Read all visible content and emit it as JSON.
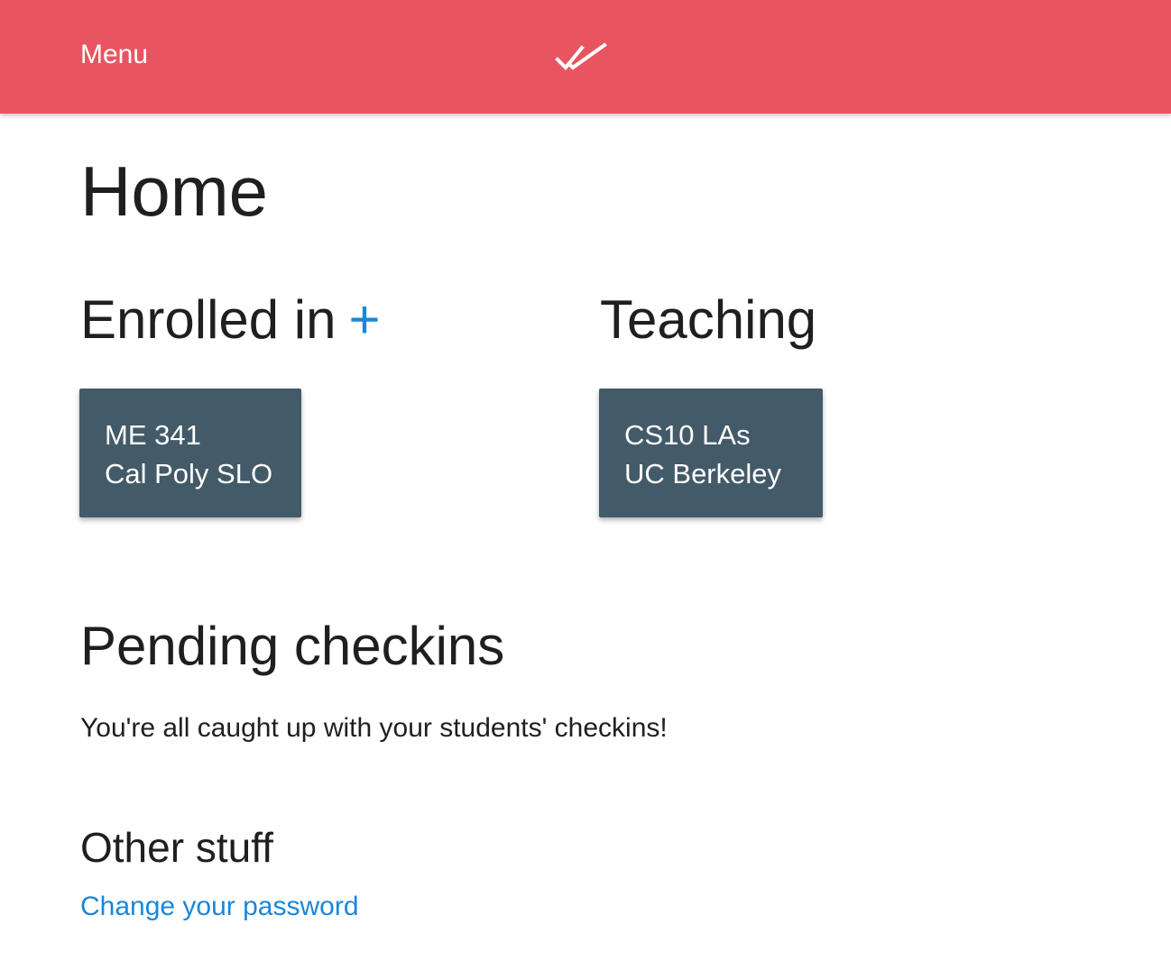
{
  "header": {
    "menu_label": "Menu",
    "logo_icon": "double-check-icon",
    "background_color": "#e85560"
  },
  "main": {
    "title": "Home",
    "enrolled": {
      "heading": "Enrolled in",
      "add_label": "+",
      "courses": [
        {
          "name": "ME 341",
          "school": "Cal Poly SLO"
        }
      ]
    },
    "teaching": {
      "heading": "Teaching",
      "courses": [
        {
          "name": "CS10 LAs",
          "school": "UC Berkeley"
        }
      ]
    },
    "pending": {
      "heading": "Pending checkins",
      "message": "You're all caught up with your students' checkins!"
    },
    "other": {
      "heading": "Other stuff",
      "change_password_label": "Change your password"
    }
  },
  "colors": {
    "card_background": "#435a68",
    "link_color": "#1a87d8"
  }
}
